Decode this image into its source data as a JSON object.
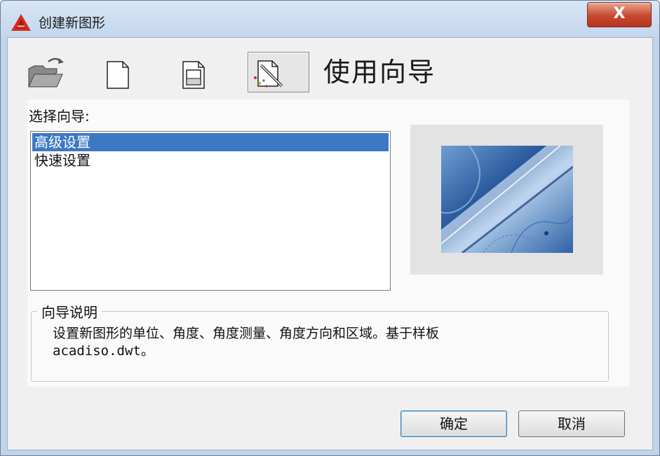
{
  "window": {
    "title": "创建新图形",
    "close_symbol": "X"
  },
  "toolbar": {
    "buttons": [
      {
        "name": "open-drawing",
        "icon": "open-folder-icon"
      },
      {
        "name": "start-from-scratch",
        "icon": "blank-page-icon"
      },
      {
        "name": "use-template",
        "icon": "template-page-icon"
      },
      {
        "name": "use-wizard",
        "icon": "wizard-pencil-icon",
        "active": true
      }
    ],
    "heading": "使用向导"
  },
  "wizard_list": {
    "label": "选择向导:",
    "items": [
      "高级设置",
      "快速设置"
    ],
    "selected_index": 0
  },
  "description": {
    "legend": "向导说明",
    "line1": "设置新图形的单位、角度、角度测量、角度方向和区域。基于样板",
    "line2": "acadiso.dwt。"
  },
  "buttons": {
    "ok": "确定",
    "cancel": "取消"
  },
  "colors": {
    "selection": "#3c79c5",
    "close_button": "#c8482f",
    "titlebar": "#c3d6ec"
  }
}
